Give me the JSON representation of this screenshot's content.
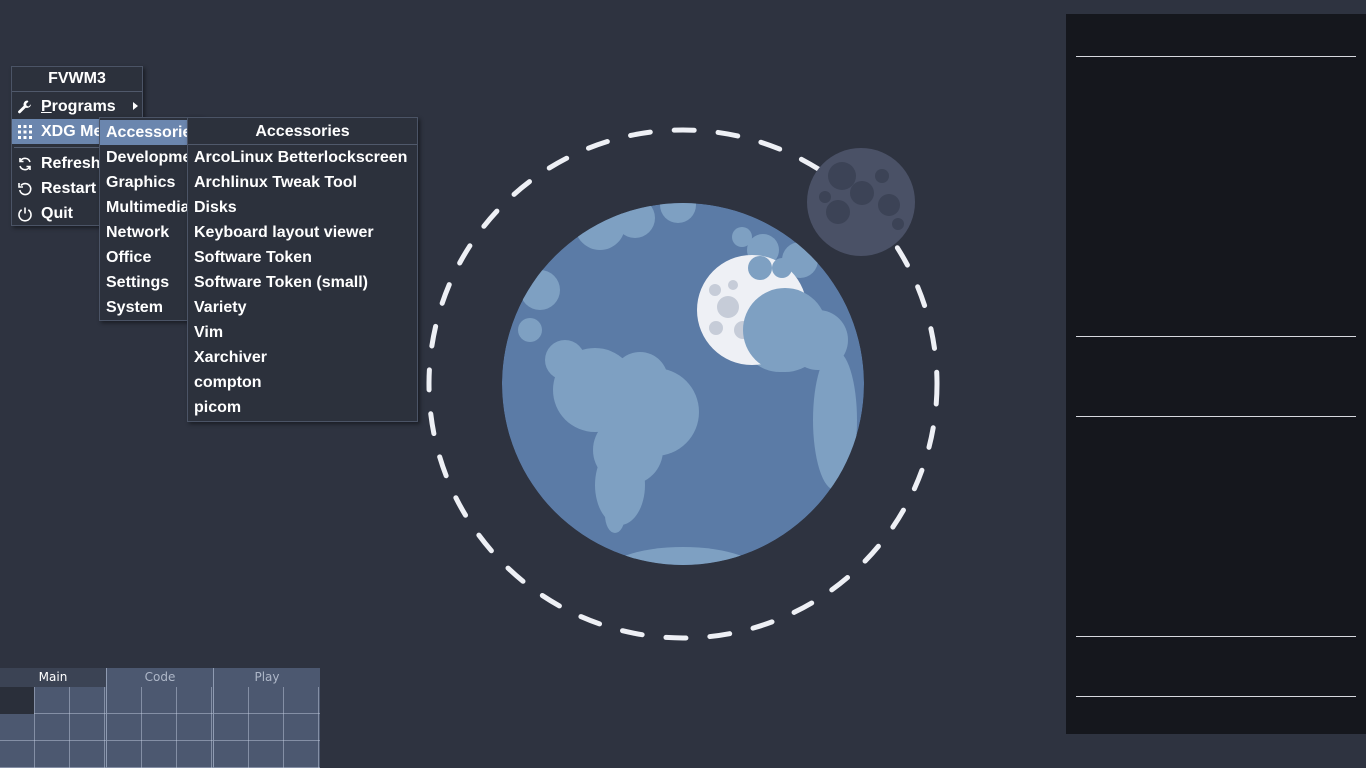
{
  "menus": {
    "root": {
      "title": "FVWM3",
      "items": [
        {
          "label": "Programs",
          "icon": "wrench-icon"
        },
        {
          "label": "XDG Menu",
          "icon": "grid-icon"
        },
        {
          "label": "Refresh",
          "icon": "refresh-icon"
        },
        {
          "label": "Restart",
          "icon": "restart-icon"
        },
        {
          "label": "Quit",
          "icon": "power-icon"
        }
      ]
    },
    "xdg": {
      "items": [
        "Accessories",
        "Development",
        "Graphics",
        "Multimedia",
        "Network",
        "Office",
        "Settings",
        "System"
      ]
    },
    "accessories": {
      "title": "Accessories",
      "items": [
        "ArcoLinux Betterlockscreen",
        "Archlinux Tweak Tool",
        "Disks",
        "Keyboard layout viewer",
        "Software Token",
        "Software Token (small)",
        "Variety",
        "Vim",
        "Xarchiver",
        "compton",
        "picom"
      ]
    }
  },
  "pager": {
    "desks": [
      "Main",
      "Code",
      "Play"
    ],
    "active_desk": "Main"
  },
  "colors": {
    "desktop_bg": "#2e3340",
    "menu_bg": "#2c313c",
    "menu_highlight": "#6b86ae",
    "earth_ocean": "#5b7ba6",
    "earth_land": "#7ea0c2",
    "moon": "#4a5166"
  }
}
